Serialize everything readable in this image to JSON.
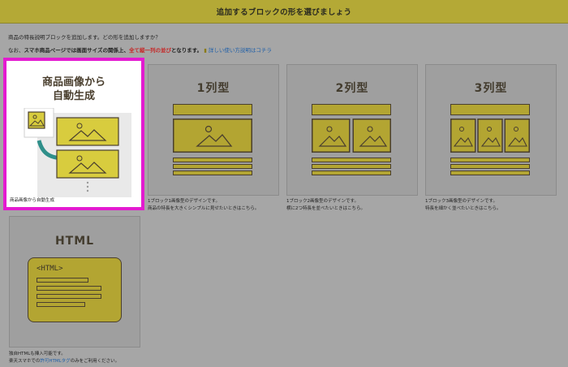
{
  "header": {
    "title": "追加するブロックの形を選びましょう"
  },
  "intro": {
    "line1": "商品の特長説明ブロックを追加します。どの形を追加しますか？",
    "line2_a": "なお、",
    "line2_b": "スマホ商品ページでは画面サイズの関係上、",
    "line2_c": "全て縦一列の並び",
    "line2_d": "となります。",
    "line2_e": "詳しい使い方説明はコチラ"
  },
  "cards": [
    {
      "title_line1": "商品画像から",
      "title_line2": "自動生成",
      "desc": [
        "商品画像から自動生成"
      ]
    },
    {
      "title": "1列型",
      "desc": [
        "1ブロック1画像型のデザインです。",
        "商品の特長を大きくシンプルに見せたいときはこちら。"
      ]
    },
    {
      "title": "2列型",
      "desc": [
        "1ブロック2画像型のデザインです。",
        "横に2つ特長を並べたいときはこちら。"
      ]
    },
    {
      "title": "3列型",
      "desc": [
        "1ブロック3画像型のデザインです。",
        "特長を細かく並べたいときはこちら。"
      ]
    },
    {
      "title": "HTML",
      "code_tag": "<HTML>",
      "desc_line1": "独自HTMLも挿入可能です。",
      "desc_line2_a": "楽天スマホでの",
      "desc_line2_b": "許可HTMLタグ",
      "desc_line2_c": "のみをご利用ください。"
    }
  ],
  "colors": {
    "header": "#b4a936",
    "accent_yellow": "#b3a532",
    "selected_border": "#e31bd0",
    "dark_line": "#4a3f2e",
    "arrow_teal": "#2f8f8a"
  }
}
